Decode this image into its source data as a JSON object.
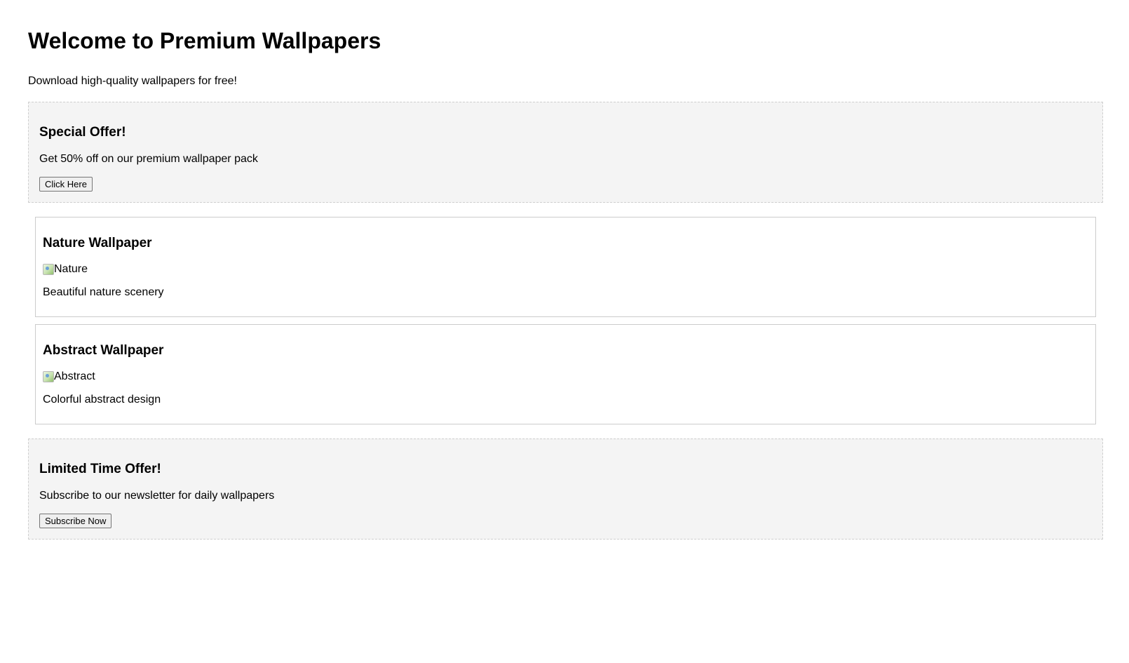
{
  "header": {
    "title": "Welcome to Premium Wallpapers",
    "subtitle": "Download high-quality wallpapers for free!"
  },
  "offers": [
    {
      "title": "Special Offer!",
      "text": "Get 50% off on our premium wallpaper pack",
      "button_label": "Click Here"
    },
    {
      "title": "Limited Time Offer!",
      "text": "Subscribe to our newsletter for daily wallpapers",
      "button_label": "Subscribe Now"
    }
  ],
  "wallpapers": [
    {
      "title": "Nature Wallpaper",
      "image_alt": "Nature",
      "description": "Beautiful nature scenery"
    },
    {
      "title": "Abstract Wallpaper",
      "image_alt": "Abstract",
      "description": "Colorful abstract design"
    }
  ],
  "icons": {
    "broken_image": "broken-image-icon"
  }
}
